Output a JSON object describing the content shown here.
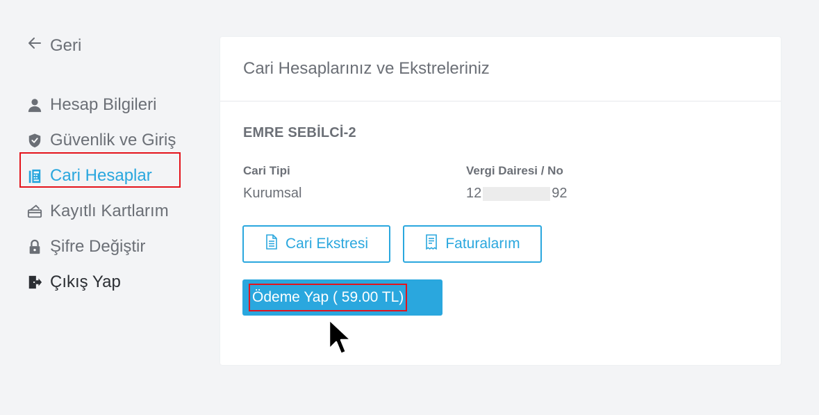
{
  "sidebar": {
    "back_label": "Geri",
    "items": [
      {
        "label": "Hesap Bilgileri",
        "icon": "user-icon"
      },
      {
        "label": "Güvenlik ve Giriş",
        "icon": "shield-icon"
      },
      {
        "label": "Cari Hesaplar",
        "icon": "building-icon",
        "active": true
      },
      {
        "label": "Kayıtlı Kartlarım",
        "icon": "card-icon"
      },
      {
        "label": "Şifre Değiştir",
        "icon": "lock-icon"
      },
      {
        "label": "Çıkış Yap",
        "icon": "logout-icon"
      }
    ]
  },
  "main": {
    "title": "Cari Hesaplarınız ve Ekstreleriniz",
    "company_name": "EMRE SEBİLCİ-2",
    "account_type_label": "Cari Tipi",
    "account_type_value": "Kurumsal",
    "tax_label": "Vergi Dairesi / No",
    "tax_prefix": "12",
    "tax_suffix": "92",
    "buttons": {
      "statement": "Cari Ekstresi",
      "invoices": "Faturalarım",
      "pay": "Ödeme Yap ( 59.00 TL)"
    }
  },
  "colors": {
    "accent": "#2aa7de",
    "highlight": "#e4131b",
    "text": "#6b6f76",
    "background": "#f3f4f6"
  }
}
